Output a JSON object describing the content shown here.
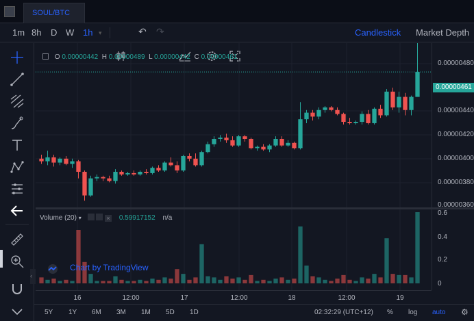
{
  "tabs": [
    {
      "label": "SOUL/BTC"
    }
  ],
  "toolbar": {
    "intervals": [
      "1m",
      "8h",
      "D",
      "W",
      "1h"
    ],
    "active_interval": "1h",
    "view_candlestick": "Candlestick",
    "view_depth": "Market Depth"
  },
  "legend": {
    "o_label": "O",
    "o_value": "0.00000442",
    "h_label": "H",
    "h_value": "0.00000489",
    "l_label": "L",
    "l_value": "0.00000442",
    "c_label": "C",
    "c_value": "0.00000461"
  },
  "last_price": "0.00000461",
  "price_axis": [
    "0.00000480",
    "0.00000440",
    "0.00000420",
    "0.00000400",
    "0.00000380",
    "0.00000360"
  ],
  "volume": {
    "label": "Volume (20)",
    "value": "0.59917152",
    "na": "n/a",
    "axis": [
      "0.6",
      "0.4",
      "0.2",
      "0"
    ]
  },
  "time_axis": [
    "16",
    "12:00",
    "17",
    "12:00",
    "18",
    "12:00",
    "19"
  ],
  "watermark": "Chart by TradingView",
  "bottom": {
    "ranges": [
      "5Y",
      "1Y",
      "6M",
      "3M",
      "1M",
      "5D",
      "1D"
    ],
    "clock": "02:32:29 (UTC+12)",
    "percent": "%",
    "log": "log",
    "auto": "auto"
  },
  "colors": {
    "up": "#26a69a",
    "down": "#ef5350",
    "accent": "#2962ff",
    "bg": "#131722"
  },
  "icons": [
    "menu-square-icon",
    "candles-icon",
    "undo-icon",
    "redo-icon",
    "indicators-icon",
    "settings-icon",
    "fullscreen-icon",
    "crosshair-icon",
    "trendline-icon",
    "fib-icon",
    "brush-icon",
    "text-icon",
    "pattern-icon",
    "measure-icon",
    "back-arrow-icon",
    "ruler-icon",
    "zoom-icon",
    "magnet-icon",
    "chevron-down-icon"
  ],
  "chart_data": {
    "type": "candlestick",
    "price_range": [
      3.6e-06,
      4.85e-06
    ],
    "volume_range": [
      0,
      0.6
    ],
    "candles": [
      [
        3.95e-06,
        3.98e-06,
        3.91e-06,
        3.93e-06,
        0.05
      ],
      [
        3.93e-06,
        4.01e-06,
        3.9e-06,
        3.96e-06,
        0.03
      ],
      [
        3.96e-06,
        3.98e-06,
        3.89e-06,
        3.92e-06,
        0.04
      ],
      [
        3.92e-06,
        3.96e-06,
        3.9e-06,
        3.95e-06,
        0.02
      ],
      [
        3.95e-06,
        3.97e-06,
        3.9e-06,
        3.91e-06,
        0.03
      ],
      [
        3.91e-06,
        3.95e-06,
        3.88e-06,
        3.93e-06,
        0.02
      ],
      [
        3.93e-06,
        3.94e-06,
        3.8e-06,
        3.85e-06,
        0.45
      ],
      [
        3.85e-06,
        3.86e-06,
        3.63e-06,
        3.67e-06,
        0.18
      ],
      [
        3.67e-06,
        3.82e-06,
        3.66e-06,
        3.8e-06,
        0.08
      ],
      [
        3.8e-06,
        3.83e-06,
        3.78e-06,
        3.81e-06,
        0.02
      ],
      [
        3.81e-06,
        3.82e-06,
        3.78e-06,
        3.8e-06,
        0.02
      ],
      [
        3.8e-06,
        3.82e-06,
        3.77e-06,
        3.78e-06,
        0.02
      ],
      [
        3.78e-06,
        3.87e-06,
        3.76e-06,
        3.85e-06,
        0.06
      ],
      [
        3.85e-06,
        3.86e-06,
        3.82e-06,
        3.83e-06,
        0.03
      ],
      [
        3.83e-06,
        3.85e-06,
        3.82e-06,
        3.84e-06,
        0.02
      ],
      [
        3.84e-06,
        3.86e-06,
        3.82e-06,
        3.83e-06,
        0.02
      ],
      [
        3.83e-06,
        3.86e-06,
        3.82e-06,
        3.85e-06,
        0.03
      ],
      [
        3.85e-06,
        3.87e-06,
        3.83e-06,
        3.84e-06,
        0.02
      ],
      [
        3.84e-06,
        3.89e-06,
        3.83e-06,
        3.88e-06,
        0.04
      ],
      [
        3.88e-06,
        3.9e-06,
        3.85e-06,
        3.86e-06,
        0.03
      ],
      [
        3.86e-06,
        3.93e-06,
        3.85e-06,
        3.92e-06,
        0.05
      ],
      [
        3.92e-06,
        3.96e-06,
        3.89e-06,
        3.9e-06,
        0.04
      ],
      [
        3.9e-06,
        3.93e-06,
        3.84e-06,
        3.86e-06,
        0.12
      ],
      [
        3.86e-06,
        3.98e-06,
        3.85e-06,
        3.97e-06,
        0.08
      ],
      [
        3.97e-06,
        3.99e-06,
        3.93e-06,
        3.95e-06,
        0.03
      ],
      [
        3.95e-06,
        3.99e-06,
        3.89e-06,
        3.9e-06,
        0.05
      ],
      [
        3.9e-06,
        4.01e-06,
        3.89e-06,
        4e-06,
        0.33
      ],
      [
        4e-06,
        4.08e-06,
        3.99e-06,
        4.06e-06,
        0.06
      ],
      [
        4.06e-06,
        4.12e-06,
        4.04e-06,
        4.1e-06,
        0.05
      ],
      [
        4.1e-06,
        4.13e-06,
        4.08e-06,
        4.11e-06,
        0.03
      ],
      [
        4.11e-06,
        4.14e-06,
        4.07e-06,
        4.09e-06,
        0.06
      ],
      [
        4.09e-06,
        4.12e-06,
        4.04e-06,
        4.05e-06,
        0.04
      ],
      [
        4.05e-06,
        4.13e-06,
        4.04e-06,
        4.12e-06,
        0.05
      ],
      [
        4.12e-06,
        4.13e-06,
        4.08e-06,
        4.1e-06,
        0.03
      ],
      [
        4.1e-06,
        4.11e-06,
        4.02e-06,
        4.03e-06,
        0.07
      ],
      [
        4.03e-06,
        4.05e-06,
        4.01e-06,
        4.04e-06,
        0.02
      ],
      [
        4.04e-06,
        4.06e-06,
        4.01e-06,
        4.02e-06,
        0.03
      ],
      [
        4.02e-06,
        4.06e-06,
        4e-06,
        4.05e-06,
        0.02
      ],
      [
        4.05e-06,
        4.12e-06,
        4.04e-06,
        4.1e-06,
        0.04
      ],
      [
        4.1e-06,
        4.12e-06,
        4.04e-06,
        4.05e-06,
        0.05
      ],
      [
        4.05e-06,
        4.09e-06,
        4.04e-06,
        4.07e-06,
        0.03
      ],
      [
        4.07e-06,
        4.08e-06,
        4.02e-06,
        4.03e-06,
        0.04
      ],
      [
        4.03e-06,
        4.38e-06,
        4.02e-06,
        4.25e-06,
        0.48
      ],
      [
        4.25e-06,
        4.32e-06,
        4.22e-06,
        4.3e-06,
        0.15
      ],
      [
        4.3e-06,
        4.32e-06,
        4.24e-06,
        4.27e-06,
        0.06
      ],
      [
        4.27e-06,
        4.34e-06,
        4.25e-06,
        4.32e-06,
        0.05
      ],
      [
        4.32e-06,
        4.35e-06,
        4.3e-06,
        4.34e-06,
        0.03
      ],
      [
        4.34e-06,
        4.35e-06,
        4.31e-06,
        4.32e-06,
        0.02
      ],
      [
        4.32e-06,
        4.34e-06,
        4.28e-06,
        4.29e-06,
        0.04
      ],
      [
        4.29e-06,
        4.3e-06,
        4.21e-06,
        4.23e-06,
        0.07
      ],
      [
        4.23e-06,
        4.26e-06,
        4.21e-06,
        4.22e-06,
        0.03
      ],
      [
        4.22e-06,
        4.24e-06,
        4.21e-06,
        4.23e-06,
        0.02
      ],
      [
        4.23e-06,
        4.31e-06,
        4.21e-06,
        4.29e-06,
        0.05
      ],
      [
        4.29e-06,
        4.32e-06,
        4.21e-06,
        4.22e-06,
        0.04
      ],
      [
        4.22e-06,
        4.34e-06,
        4.21e-06,
        4.33e-06,
        0.08
      ],
      [
        4.33e-06,
        4.36e-06,
        4.26e-06,
        4.28e-06,
        0.05
      ],
      [
        4.28e-06,
        4.48e-06,
        4.27e-06,
        4.46e-06,
        0.38
      ],
      [
        4.46e-06,
        4.49e-06,
        4.32e-06,
        4.34e-06,
        0.08
      ],
      [
        4.34e-06,
        4.46e-06,
        4.3e-06,
        4.42e-06,
        0.07
      ],
      [
        4.42e-06,
        4.45e-06,
        4.28e-06,
        4.32e-06,
        0.07
      ],
      [
        4.32e-06,
        4.43e-06,
        4.28e-06,
        4.42e-06,
        0.05
      ],
      [
        4.42e-06,
        4.89e-06,
        4.42e-06,
        4.61e-06,
        0.6
      ]
    ]
  }
}
